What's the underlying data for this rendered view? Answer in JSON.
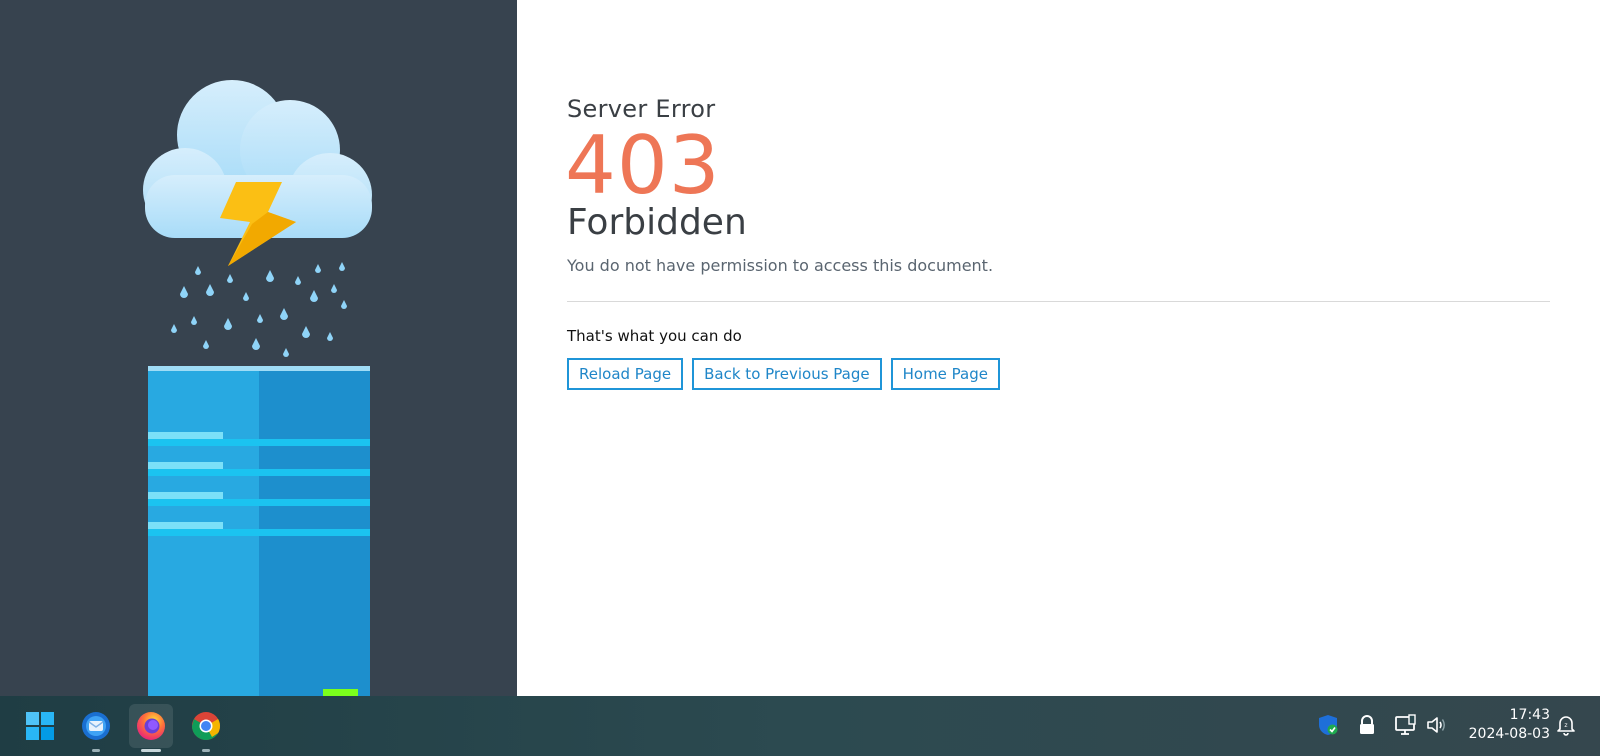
{
  "error": {
    "subtitle": "Server Error",
    "code": "403",
    "title": "Forbidden",
    "description": "You do not have permission to access this document.",
    "options_label": "That's what you can do",
    "buttons": {
      "reload": "Reload Page",
      "back": "Back to Previous Page",
      "home": "Home Page"
    }
  },
  "illustration": {
    "icons": [
      "cloud-icon",
      "lightning-icon",
      "raindrops-icon",
      "server-icon"
    ]
  },
  "taskbar": {
    "apps": [
      "start-icon",
      "thunderbird-icon",
      "firefox-icon",
      "chrome-icon"
    ],
    "active_app": "firefox-icon",
    "tray": [
      "security-shield-icon",
      "lock-icon",
      "network-icon",
      "volume-icon",
      "notification-icon"
    ],
    "time": "17:43",
    "date": "2024-08-03"
  },
  "colors": {
    "panel": "#37434f",
    "accent": "#ee7656",
    "button": "#1f95d8"
  }
}
